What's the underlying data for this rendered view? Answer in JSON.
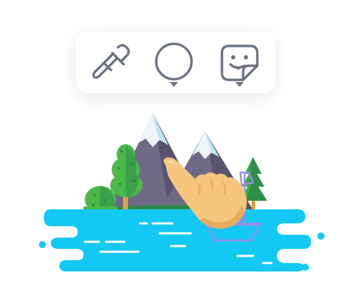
{
  "toolbar": {
    "tools": [
      {
        "icon": "eyedropper-icon",
        "has_dropdown": false
      },
      {
        "icon": "circle-shape-icon",
        "has_dropdown": true
      },
      {
        "icon": "sticker-face-icon",
        "has_dropdown": true
      }
    ],
    "colors": {
      "icon_stroke": "#6a7381",
      "caret": "#6a7381",
      "panel_bg": "#ffffff"
    }
  },
  "scene": {
    "colors": {
      "water": "#14c8f4",
      "water_foam": "#ffffff",
      "mountain": "#6e6a86",
      "mountain_shade": "#58546d",
      "snow": "#eef4f8",
      "snow_blue": "#bfe4f2",
      "tree_light": "#4cb84a",
      "tree_dark": "#2e8e48",
      "trunk": "#e0a13a",
      "grass": "#2c8a46",
      "boat_outline": "#9b8ee8",
      "hand": "#f6c67e",
      "hand_shade": "#e9a85a"
    }
  }
}
